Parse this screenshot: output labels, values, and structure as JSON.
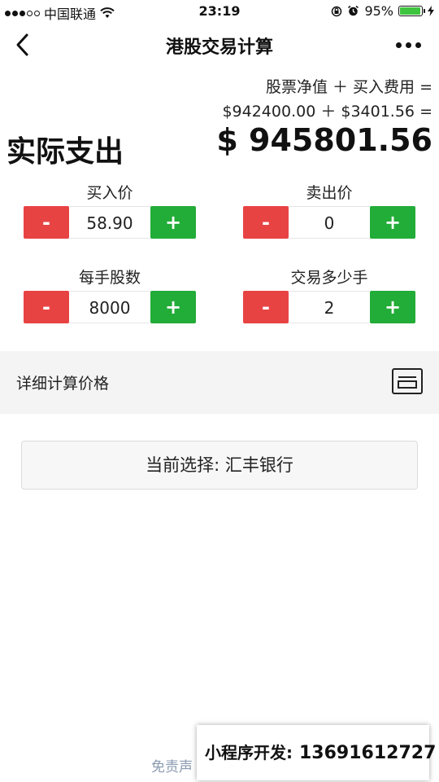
{
  "status": {
    "carrier": "中国联通",
    "time": "23:19",
    "battery": "95%",
    "battery_level": 0.95,
    "battery_color": "#3fc43f"
  },
  "nav": {
    "title": "港股交易计算"
  },
  "summary": {
    "formula_line1": "股票净值 ＋ 买入费用 =",
    "formula_line2": "$942400.00 ＋ $3401.56 =",
    "actual_label": "实际支出",
    "actual_value": "$ 945801.56"
  },
  "fields": [
    {
      "label": "买入价",
      "value": "58.90",
      "minus": "-",
      "plus": "+"
    },
    {
      "label": "卖出价",
      "value": "0",
      "minus": "-",
      "plus": "+"
    },
    {
      "label": "每手股数",
      "value": "8000",
      "minus": "-",
      "plus": "+"
    },
    {
      "label": "交易多少手",
      "value": "2",
      "minus": "-",
      "plus": "+"
    }
  ],
  "detail": {
    "label": "详细计算价格",
    "icon": "card-icon"
  },
  "selection": {
    "label": "当前选择: 汇丰银行"
  },
  "footer": {
    "disclaimer": "免责声",
    "contact_label": "小程序开发:",
    "contact_number": "13691612727"
  },
  "colors": {
    "minus": "#e84343",
    "plus": "#22ac38",
    "detail_bg": "#f4f4f4"
  }
}
